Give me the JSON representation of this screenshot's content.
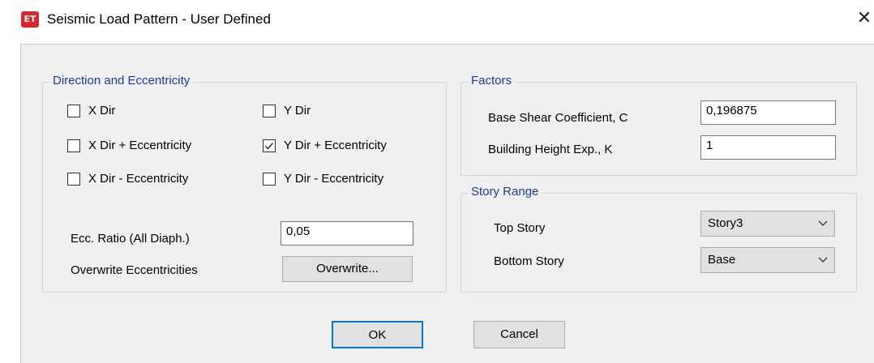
{
  "window": {
    "title": "Seismic Load Pattern - User Defined",
    "app_icon_text": "ET",
    "close_glyph": "✕"
  },
  "direction": {
    "title": "Direction and Eccentricity",
    "checkboxes": [
      {
        "label": "X Dir",
        "checked": false
      },
      {
        "label": "Y Dir",
        "checked": false
      },
      {
        "label": "X Dir + Eccentricity",
        "checked": false
      },
      {
        "label": "Y Dir + Eccentricity",
        "checked": true
      },
      {
        "label": "X Dir - Eccentricity",
        "checked": false
      },
      {
        "label": "Y Dir - Eccentricity",
        "checked": false
      }
    ],
    "ecc_ratio_label": "Ecc. Ratio (All Diaph.)",
    "ecc_ratio_value": "0,05",
    "overwrite_label": "Overwrite Eccentricities",
    "overwrite_button": "Overwrite..."
  },
  "factors": {
    "title": "Factors",
    "base_shear_label": "Base Shear Coefficient, C",
    "base_shear_value": "0,196875",
    "height_exp_label": "Building Height Exp., K",
    "height_exp_value": "1"
  },
  "story_range": {
    "title": "Story Range",
    "top_label": "Top Story",
    "top_value": "Story3",
    "bottom_label": "Bottom Story",
    "bottom_value": "Base"
  },
  "buttons": {
    "ok": "OK",
    "cancel": "Cancel"
  }
}
